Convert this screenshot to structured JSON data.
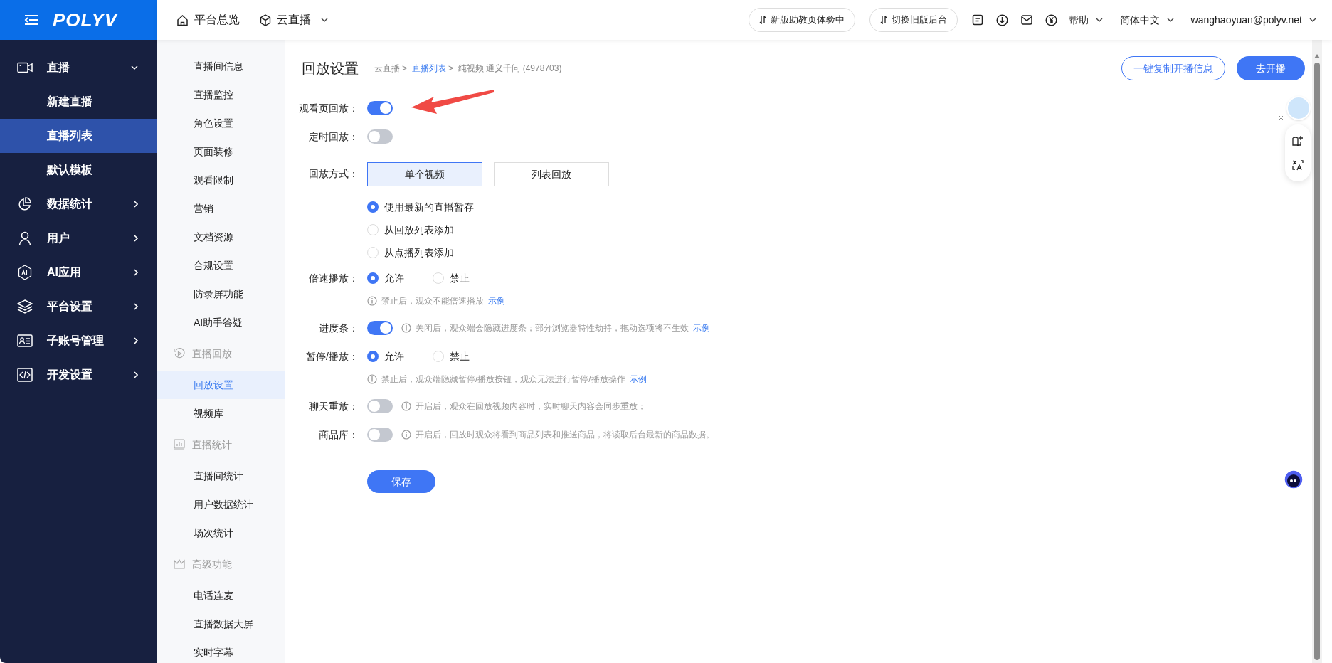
{
  "header": {
    "logo": "POLYV",
    "nav": [
      {
        "label": "平台总览",
        "dropdown": false
      },
      {
        "label": "云直播",
        "dropdown": true
      }
    ],
    "actions": [
      "新版助教页体验中",
      "切换旧版后台"
    ],
    "menus": [
      {
        "label": "帮助"
      },
      {
        "label": "简体中文"
      },
      {
        "label": "wanghaoyuan@polyv.net"
      }
    ]
  },
  "sidebar": {
    "items": [
      {
        "label": "直播",
        "expanded": true,
        "selected": false,
        "children": [
          {
            "label": "新建直播",
            "selected": false
          },
          {
            "label": "直播列表",
            "selected": true
          },
          {
            "label": "默认模板",
            "selected": false
          }
        ]
      },
      {
        "label": "数据统计",
        "expanded": false,
        "selected": false
      },
      {
        "label": "用户",
        "expanded": false,
        "selected": false
      },
      {
        "label": "AI应用",
        "expanded": false,
        "selected": false
      },
      {
        "label": "平台设置",
        "expanded": false,
        "selected": false
      },
      {
        "label": "子账号管理",
        "expanded": false,
        "selected": false
      },
      {
        "label": "开发设置",
        "expanded": false,
        "selected": false
      }
    ]
  },
  "submenu": {
    "groups": [
      {
        "items": [
          {
            "label": "直播间信息",
            "selected": false
          },
          {
            "label": "直播监控",
            "selected": false
          },
          {
            "label": "角色设置",
            "selected": false
          },
          {
            "label": "页面装修",
            "selected": false
          },
          {
            "label": "观看限制",
            "selected": false
          },
          {
            "label": "营销",
            "selected": false
          },
          {
            "label": "文档资源",
            "selected": false
          },
          {
            "label": "合规设置",
            "selected": false
          },
          {
            "label": "防录屏功能",
            "selected": false
          },
          {
            "label": "AI助手答疑",
            "selected": false
          }
        ]
      },
      {
        "title": "直播回放",
        "items": [
          {
            "label": "回放设置",
            "selected": true
          },
          {
            "label": "视频库",
            "selected": false
          }
        ]
      },
      {
        "title": "直播统计",
        "items": [
          {
            "label": "直播间统计",
            "selected": false
          },
          {
            "label": "用户数据统计",
            "selected": false
          },
          {
            "label": "场次统计",
            "selected": false
          }
        ]
      },
      {
        "title": "高级功能",
        "items": [
          {
            "label": "电话连麦",
            "selected": false
          },
          {
            "label": "直播数据大屏",
            "selected": false
          },
          {
            "label": "实时字幕",
            "selected": false
          }
        ]
      }
    ]
  },
  "page": {
    "title": "回放设置",
    "breadcrumb": {
      "separator": ">",
      "items": [
        {
          "label": "云直播",
          "link": false
        },
        {
          "label": "直播列表",
          "link": true
        },
        {
          "label": "纯视频 通义千问 (4978703)",
          "link": false
        }
      ]
    },
    "buttons": [
      {
        "label": "一键复制开播信息",
        "kind": "outline"
      },
      {
        "label": "去开播",
        "kind": "primary"
      }
    ]
  },
  "form": {
    "rows": [
      {
        "kind": "toggle",
        "label": "观看页回放：",
        "on": true
      },
      {
        "kind": "toggle",
        "label": "定时回放：",
        "on": false
      },
      {
        "kind": "segmented",
        "label": "回放方式：",
        "options": [
          {
            "label": "单个视频",
            "selected": true
          },
          {
            "label": "列表回放",
            "selected": false
          }
        ],
        "radios": [
          {
            "label": "使用最新的直播暂存",
            "selected": true
          },
          {
            "label": "从回放列表添加",
            "selected": false
          },
          {
            "label": "从点播列表添加",
            "selected": false
          }
        ]
      },
      {
        "kind": "radio",
        "label": "倍速播放：",
        "options": [
          {
            "label": "允许",
            "selected": true
          },
          {
            "label": "禁止",
            "selected": false
          }
        ],
        "hint": {
          "text": "禁止后，观众不能倍速播放",
          "link": "示例"
        }
      },
      {
        "kind": "toggle",
        "label": "进度条：",
        "on": true,
        "hint": {
          "text": "关闭后，观众端会隐藏进度条；部分浏览器特性劫持，拖动选项将不生效",
          "link": "示例"
        }
      },
      {
        "kind": "radio",
        "label": "暂停/播放：",
        "options": [
          {
            "label": "允许",
            "selected": true
          },
          {
            "label": "禁止",
            "selected": false
          }
        ],
        "hint": {
          "text": "禁止后，观众端隐藏暂停/播放按钮，观众无法进行暂停/播放操作",
          "link": "示例"
        }
      },
      {
        "kind": "toggle",
        "label": "聊天重放：",
        "on": false,
        "hint": {
          "text": "开启后，观众在回放视频内容时，实时聊天内容会同步重放；"
        }
      },
      {
        "kind": "toggle",
        "label": "商品库：",
        "on": false,
        "hint": {
          "text": "开启后，回放时观众将看到商品列表和推送商品，将读取后台最新的商品数据。"
        }
      }
    ],
    "submit": "保存"
  }
}
